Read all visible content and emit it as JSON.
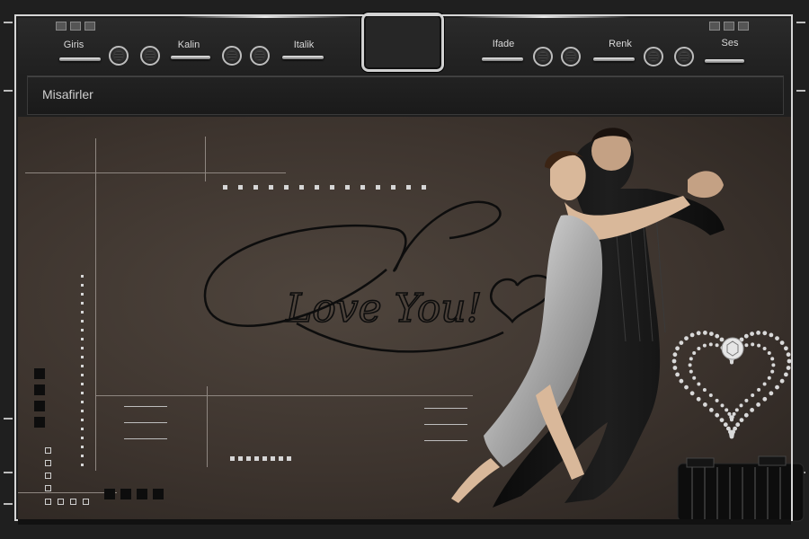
{
  "toolbar": {
    "items": [
      {
        "label": "Giris"
      },
      {
        "label": "Kalin"
      },
      {
        "label": "Italik"
      },
      {
        "label": "Ifade"
      },
      {
        "label": "Renk"
      },
      {
        "label": "Ses"
      }
    ]
  },
  "guests": {
    "label": "Misafirler"
  },
  "artwork": {
    "script_text": "Love You!"
  },
  "colors": {
    "frame": "#1f1f1f",
    "panel": "#3d342e",
    "accent": "#d6d6d6"
  }
}
